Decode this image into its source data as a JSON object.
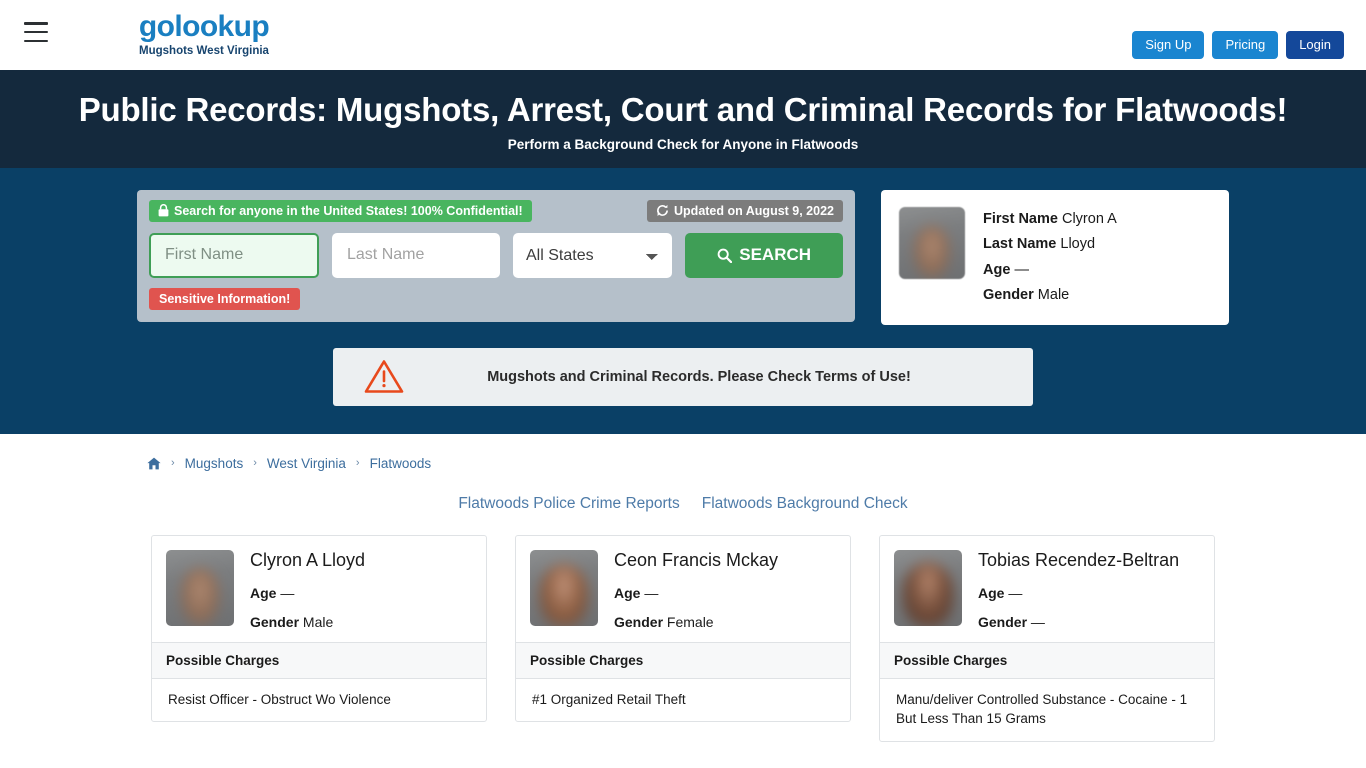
{
  "header": {
    "menu_icon": "hamburger-icon",
    "logo_text_light": "go",
    "logo_text_mid": "lookup",
    "logo_full": "golookup",
    "logo_subtitle": "Mugshots West Virginia",
    "buttons": {
      "signup": "Sign Up",
      "pricing": "Pricing",
      "login": "Login"
    },
    "colors": {
      "signup_bg": "#1a85d0",
      "pricing_bg": "#1a85d0",
      "login_bg": "#14489a",
      "logo_blue": "#1a7fc1",
      "logo_dark": "#17446e"
    }
  },
  "hero": {
    "title": "Public Records: Mugshots, Arrest, Court and Criminal Records for Flatwoods!",
    "subtitle": "Perform a Background Check for Anyone in Flatwoods",
    "title_band_bg": "#14293d",
    "body_bg": "#0a4066"
  },
  "search": {
    "panel_bg": "#b5c0ca",
    "confidential_badge": {
      "icon": "lock-icon",
      "text": "Search for anyone in the United States! 100% Confidential!",
      "bg": "#49b55f"
    },
    "updated_badge": {
      "icon": "refresh-icon",
      "text": "Updated on August 9, 2022",
      "bg": "#7c7c7c"
    },
    "first_name": {
      "value": "",
      "placeholder": "First Name",
      "focused": true
    },
    "last_name": {
      "value": "",
      "placeholder": "Last Name"
    },
    "state_select": {
      "selected": "All States",
      "options": [
        "All States"
      ]
    },
    "search_button": {
      "label": "SEARCH",
      "icon": "search-icon",
      "bg": "#3f9e56"
    },
    "sensitive_badge": {
      "text": "Sensitive Information!",
      "bg": "#e0544f"
    }
  },
  "featured_profile": {
    "avatar": "blurred-mugshot",
    "rows": [
      {
        "label": "First Name",
        "value": "Clyron A"
      },
      {
        "label": "Last Name",
        "value": "Lloyd"
      },
      {
        "label": "Age",
        "value": "—"
      },
      {
        "label": "Gender",
        "value": "Male"
      }
    ]
  },
  "alert": {
    "icon": "warning-triangle-icon",
    "icon_color": "#e8491c",
    "text": "Mugshots and Criminal Records. Please Check Terms of Use!",
    "bg": "#eceff1"
  },
  "breadcrumb": {
    "home_icon": "home-icon",
    "separator": "›",
    "items": [
      "Mugshots",
      "West Virginia",
      "Flatwoods"
    ]
  },
  "quick_links": [
    "Flatwoods Police Crime Reports",
    "Flatwoods Background Check"
  ],
  "records": {
    "charges_header": "Possible Charges",
    "age_label": "Age",
    "gender_label": "Gender",
    "items": [
      {
        "name": "Clyron A Lloyd",
        "age": "—",
        "gender": "Male",
        "charge": "Resist Officer - Obstruct Wo Violence",
        "avatar": "blurred-mugshot-male"
      },
      {
        "name": "Ceon Francis Mckay",
        "age": "—",
        "gender": "Female",
        "charge": "#1 Organized Retail Theft",
        "avatar": "blurred-mugshot-female"
      },
      {
        "name": "Tobias Recendez-Beltran",
        "age": "—",
        "gender": "—",
        "charge": "Manu/deliver Controlled Substance - Cocaine - 1 But Less Than 15 Grams",
        "avatar": "blurred-mugshot-female"
      }
    ]
  }
}
